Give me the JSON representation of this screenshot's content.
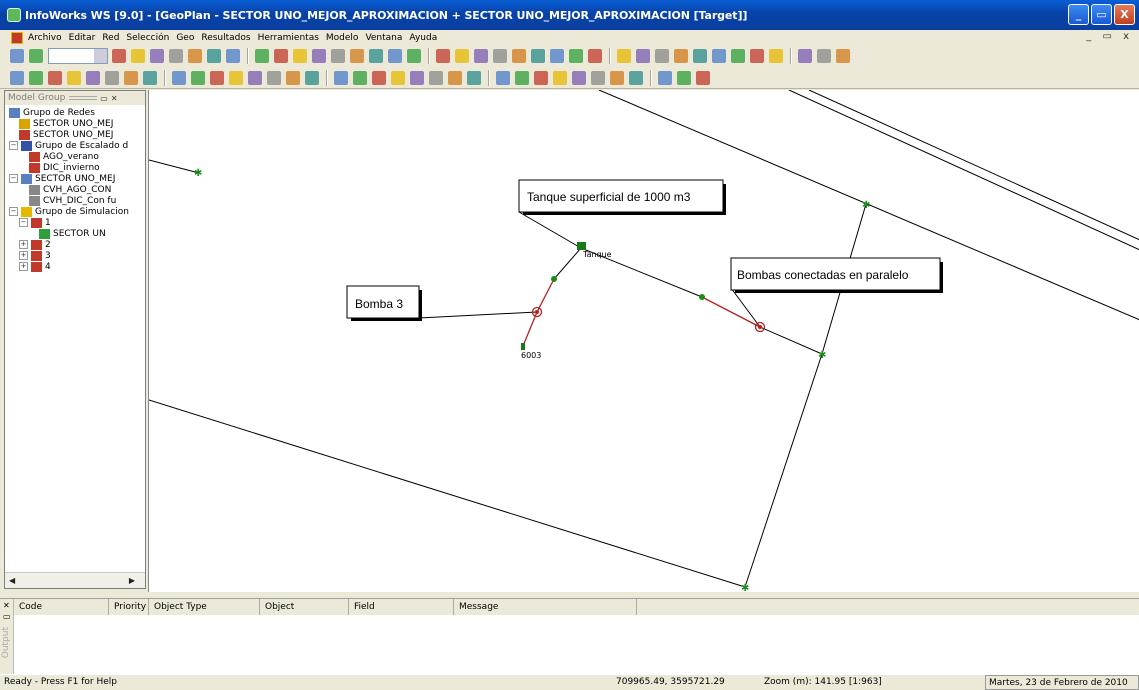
{
  "window": {
    "title": "InfoWorks WS [9.0] - [GeoPlan - SECTOR UNO_MEJOR_APROXIMACION + SECTOR UNO_MEJOR_APROXIMACION [Target]]",
    "minimize_label": "_",
    "maximize_label": "▭",
    "close_label": "X",
    "mdi_controls": "_ ▭ x"
  },
  "menu": [
    "Archivo",
    "Editar",
    "Red",
    "Selección",
    "Geo",
    "Resultados",
    "Herramientas",
    "Modelo",
    "Ventana",
    "Ayuda"
  ],
  "toolbar": {
    "row1_icons": [
      "pencil-icon",
      "plot-icon",
      "open-icon",
      "save-icon",
      "print-icon",
      "select-icon",
      "select-area-icon",
      "select-polygon-icon",
      "select-line-icon",
      "grid-view-icon",
      "graph-view-icon",
      "table-icon",
      "text-icon",
      "ruler-icon",
      "node-icon",
      "pipe-icon",
      "valve-icon",
      "pump-icon",
      "tank-icon",
      "meter-icon",
      "hydrant-icon",
      "customer-icon",
      "reservoir-icon",
      "polygon-icon",
      "pan-icon",
      "zoom-in-icon",
      "zoom-out-icon",
      "refresh-icon",
      "back-icon",
      "first-icon",
      "prev-icon",
      "pause-icon",
      "next-icon",
      "play-icon",
      "record-icon",
      "loop-icon",
      "fast-forward-icon",
      "animate-icon",
      "stop-icon"
    ],
    "row2_icons": [
      "target-icon",
      "zoom-window-icon",
      "zoom-all-icon",
      "zoom-prev-icon",
      "zoom-next-icon",
      "hand-icon",
      "dot-icon",
      "check-model-icon",
      "flow-icon",
      "map-icon",
      "report-icon",
      "export-icon",
      "import-icon",
      "import-geo-icon",
      "grid-edit-icon",
      "control-icon",
      "demand-icon",
      "calendar-icon",
      "ddg-icon",
      "profile-icon",
      "longsection-icon",
      "cross-icon",
      "stats-icon",
      "validate-icon",
      "approve-icon",
      "connect-icon",
      "sim-icon",
      "chart-icon",
      "branch-icon",
      "branch2-icon",
      "branch3-icon",
      "trace-icon",
      "find-icon",
      "find-next-icon",
      "find-all-icon"
    ]
  },
  "tree": {
    "header": "Model Group",
    "items": [
      {
        "label": "Grupo de Redes",
        "level": 0,
        "expander": "",
        "icon": "folder-icon",
        "color": "#5a7fbf"
      },
      {
        "label": "SECTOR UNO_MEJ",
        "level": 1,
        "expander": "",
        "icon": "network-icon",
        "color": "#d9a400"
      },
      {
        "label": "SECTOR UNO_MEJ",
        "level": 1,
        "expander": "",
        "icon": "control-icon",
        "color": "#c0392b"
      },
      {
        "label": "Grupo de Escalado d",
        "level": 0,
        "expander": "−",
        "icon": "scaling-group-icon",
        "color": "#3451a3"
      },
      {
        "label": "AGO_verano",
        "level": 2,
        "expander": "",
        "icon": "demand-diagram-icon",
        "color": "#c0392b"
      },
      {
        "label": "DIC_invierno",
        "level": 2,
        "expander": "",
        "icon": "demand-diagram-icon",
        "color": "#c0392b"
      },
      {
        "label": "SECTOR UNO_MEJ",
        "level": 0,
        "expander": "−",
        "icon": "catalogue-icon",
        "color": "#5a7fbf"
      },
      {
        "label": "CVH_AGO_CON",
        "level": 2,
        "expander": "",
        "icon": "document-icon",
        "color": "#888888"
      },
      {
        "label": "CVH_DIC_Con fu",
        "level": 2,
        "expander": "",
        "icon": "document-icon",
        "color": "#888888"
      },
      {
        "label": "Grupo de Simulacion",
        "level": 0,
        "expander": "−",
        "icon": "folder-icon",
        "color": "#e6b800"
      },
      {
        "label": "1",
        "level": 1,
        "expander": "−",
        "icon": "run-icon",
        "color": "#c0392b"
      },
      {
        "label": "SECTOR UN",
        "level": 3,
        "expander": "",
        "icon": "simulation-icon",
        "color": "#2e9d3a"
      },
      {
        "label": "2",
        "level": 1,
        "expander": "+",
        "icon": "run-icon",
        "color": "#c0392b"
      },
      {
        "label": "3",
        "level": 1,
        "expander": "+",
        "icon": "run-icon",
        "color": "#c0392b"
      },
      {
        "label": "4",
        "level": 1,
        "expander": "+",
        "icon": "run-icon",
        "color": "#c0392b"
      }
    ]
  },
  "map": {
    "callouts": {
      "tanque": "Tanque superficial de 1000 m3",
      "bomba3": "Bomba 3",
      "bombas": "Bombas conectadas en paralelo"
    },
    "node_labels": {
      "tank": "Tanque",
      "node_6003": "6003"
    },
    "colors": {
      "pipe": "#000000",
      "pump_link": "#b22222",
      "node": "#1a8a1a",
      "tank": "#1a7a1a"
    }
  },
  "output": {
    "side_label": "Output",
    "columns": [
      "Code",
      "Priority",
      "Object Type",
      "Object",
      "Field",
      "Message"
    ]
  },
  "status": {
    "ready": "Ready - Press F1 for Help",
    "coords": "709965.49, 3595721.29",
    "zoom": "Zoom (m): 141.95 [1:963]",
    "date": "Martes, 23 de Febrero de 2010"
  }
}
